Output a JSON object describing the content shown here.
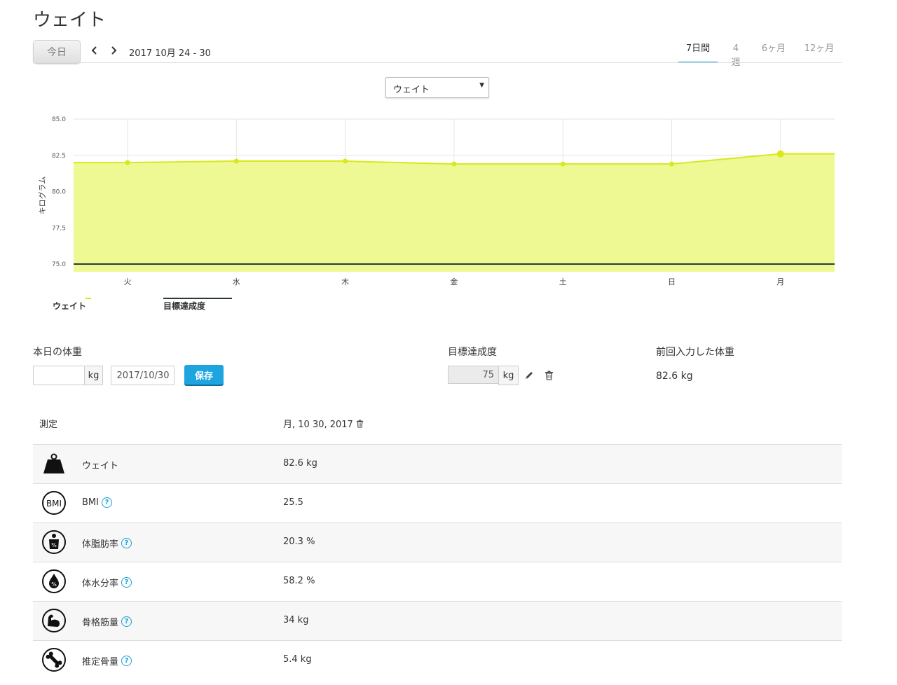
{
  "header": {
    "title": "ウェイト",
    "today_label": "今日",
    "prev_icon": "chevron-left-icon",
    "next_icon": "chevron-right-icon",
    "date_range": "2017 10月 24 - 30",
    "range_tabs": [
      {
        "label": "7日間",
        "active": true
      },
      {
        "label": "4週",
        "active": false
      },
      {
        "label": "6ヶ月",
        "active": false
      },
      {
        "label": "12ヶ月",
        "active": false
      }
    ]
  },
  "metric_select": {
    "value": "ウェイト"
  },
  "chart_data": {
    "type": "area",
    "ylabel": "キログラム",
    "ylim": [
      75.0,
      85.0
    ],
    "yticks": [
      "85.0",
      "82.5",
      "80.0",
      "77.5",
      "75.0"
    ],
    "categories": [
      "火",
      "水",
      "木",
      "金",
      "土",
      "日",
      "月"
    ],
    "series": [
      {
        "name": "ウェイト",
        "values": [
          82.0,
          82.1,
          82.1,
          81.9,
          81.9,
          81.9,
          82.6
        ],
        "color": "#d8e81c",
        "fill": "#eef993"
      },
      {
        "name": "目標達成度",
        "values": [
          75,
          75,
          75,
          75,
          75,
          75,
          75
        ],
        "color": "#2a3a3a"
      }
    ],
    "grid": true,
    "legend_position": "bottom-left"
  },
  "form": {
    "today_weight_label": "本日の体重",
    "weight_value": "",
    "unit": "kg",
    "date_value": "2017/10/30",
    "save_label": "保存",
    "goal_label": "目標達成度",
    "goal_value": "75",
    "goal_unit": "kg",
    "edit_icon": "pencil-icon",
    "delete_icon": "trash-icon",
    "last_weight_label": "前回入力した体重",
    "last_weight_value": "82.6 kg"
  },
  "measurements": {
    "header_label": "測定",
    "date": "月, 10 30, 2017",
    "rows": [
      {
        "icon": "weight-icon",
        "label": "ウェイト",
        "value": "82.6  kg",
        "help": false
      },
      {
        "icon": "bmi-icon",
        "label": "BMI",
        "value": "25.5",
        "help": true
      },
      {
        "icon": "body-fat-icon",
        "label": "体脂肪率",
        "value": "20.3  %",
        "help": true
      },
      {
        "icon": "body-water-icon",
        "label": "体水分率",
        "value": "58.2  %",
        "help": true
      },
      {
        "icon": "muscle-icon",
        "label": "骨格筋量",
        "value": "34  kg",
        "help": true
      },
      {
        "icon": "bone-icon",
        "label": "推定骨量",
        "value": "5.4  kg",
        "help": true
      }
    ]
  },
  "colors": {
    "accent": "#1aa0d8",
    "weight_line": "#d8e81c",
    "weight_fill": "#eef993",
    "goal_line": "#2a3a3a"
  }
}
